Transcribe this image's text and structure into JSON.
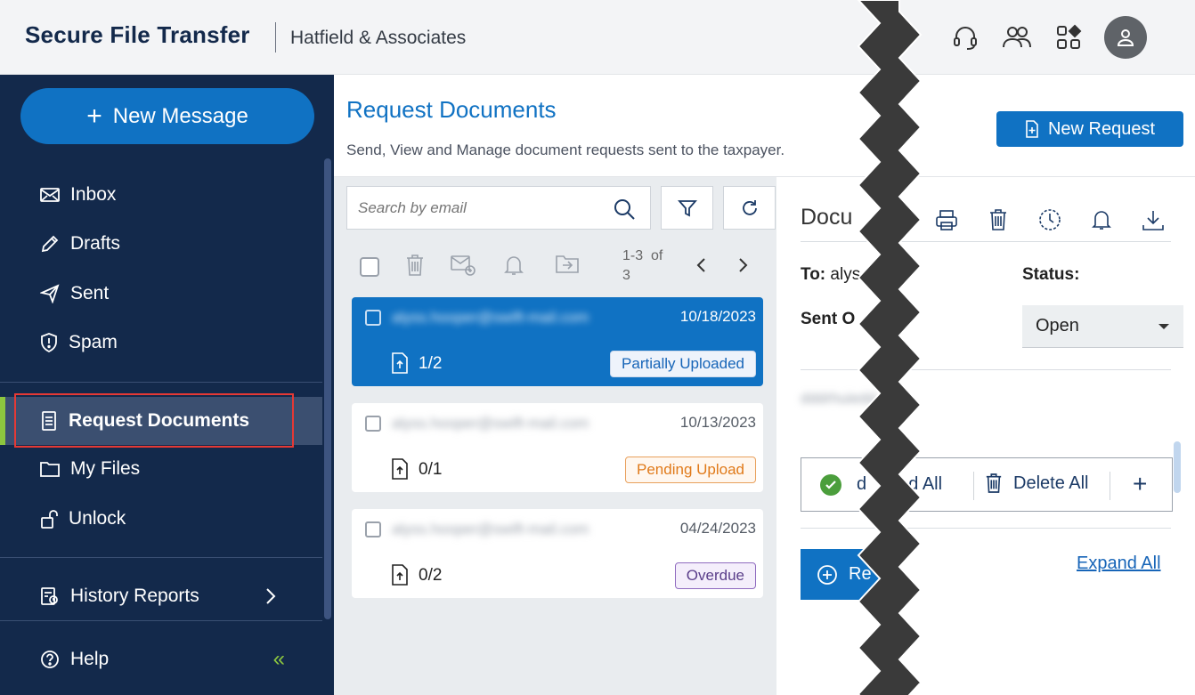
{
  "header": {
    "brand": "Secure File Transfer",
    "firm": "Hatfield & Associates",
    "icons": [
      "headset-icon",
      "users-icon",
      "apps-icon",
      "avatar-icon"
    ]
  },
  "sidebar": {
    "new_message_label": "New Message",
    "items": [
      {
        "label": "Inbox",
        "icon": "envelope-icon"
      },
      {
        "label": "Drafts",
        "icon": "pencil-icon"
      },
      {
        "label": "Sent",
        "icon": "send-icon"
      },
      {
        "label": "Spam",
        "icon": "shield-icon"
      },
      {
        "label": "Request Documents",
        "icon": "document-icon",
        "active": true
      },
      {
        "label": "My Files",
        "icon": "folder-icon"
      },
      {
        "label": "Unlock",
        "icon": "unlock-icon"
      },
      {
        "label": "History Reports",
        "icon": "report-icon"
      },
      {
        "label": "Help",
        "icon": "help-icon"
      }
    ],
    "collapse_glyph": "«"
  },
  "main": {
    "title": "Request Documents",
    "subtitle": "Send, View and Manage document requests sent to the taxpayer.",
    "new_request_label": "New Request",
    "search": {
      "placeholder": "Search by email",
      "value": ""
    },
    "pager": {
      "range": "1-3",
      "of_label": "of",
      "total": "3"
    },
    "requests": [
      {
        "email": "alyss.hooper@swift-mail.com",
        "date": "10/18/2023",
        "count": "1/2",
        "status": "Partially Uploaded",
        "selected": true
      },
      {
        "email": "alyss.hooper@swift-mail.com",
        "date": "10/13/2023",
        "count": "0/1",
        "status": "Pending Upload",
        "selected": false
      },
      {
        "email": "alyss.hooper@swift-mail.com",
        "date": "04/24/2023",
        "count": "0/2",
        "status": "Overdue",
        "selected": false
      }
    ]
  },
  "detail": {
    "title_partial": "Docu",
    "to_label": "To:",
    "to_value_partial": "alys",
    "sent_on_partial": "Sent O",
    "status_label": "Status:",
    "status_value": "Open",
    "blurred_text": "dddrhuiedd",
    "download_all_partial": "d",
    "download_all_tail": "ad All",
    "delete_all_label": "Delete All",
    "add_glyph": "+",
    "request_btn_partial": "Re",
    "expand_all_label": "Expand All"
  },
  "colors": {
    "brand_navy": "#13294b",
    "accent_blue": "#1072c3",
    "active_green": "#8cc63f",
    "highlight_red": "#e53935"
  }
}
